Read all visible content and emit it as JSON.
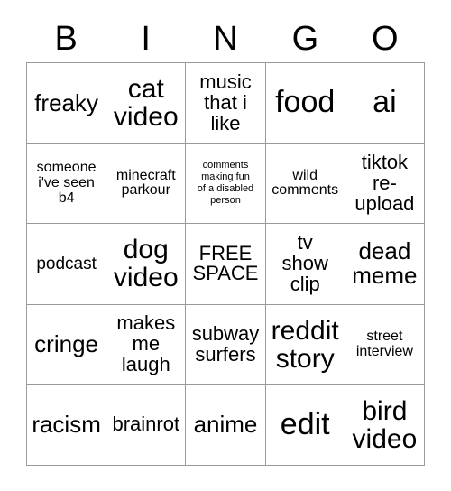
{
  "card": {
    "title": "BINGO",
    "header_letters": [
      "B",
      "I",
      "N",
      "G",
      "O"
    ],
    "grid_size": "5x5",
    "free_space_position": "center",
    "colors": {
      "background": "#ffffff",
      "text": "#000000",
      "grid_line": "#9a9a9a"
    },
    "rows": [
      [
        {
          "text": "freaky",
          "size": "s-lg"
        },
        {
          "text": "cat\nvideo",
          "size": "s-xl"
        },
        {
          "text": "music\nthat i\nlike",
          "size": "s-md"
        },
        {
          "text": "food",
          "size": "s-xxl"
        },
        {
          "text": "ai",
          "size": "s-xxl"
        }
      ],
      [
        {
          "text": "someone\ni've seen\nb4",
          "size": "s-xs"
        },
        {
          "text": "minecraft\nparkour",
          "size": "s-xs"
        },
        {
          "text": "comments\nmaking fun\nof a disabled\nperson",
          "size": "s-xxs"
        },
        {
          "text": "wild\ncomments",
          "size": "s-xs"
        },
        {
          "text": "tiktok\nre-\nupload",
          "size": "s-md"
        }
      ],
      [
        {
          "text": "podcast",
          "size": "s-sm"
        },
        {
          "text": "dog\nvideo",
          "size": "s-xl"
        },
        {
          "text": "FREE\nSPACE",
          "size": "s-md"
        },
        {
          "text": "tv\nshow\nclip",
          "size": "s-md"
        },
        {
          "text": "dead\nmeme",
          "size": "s-lg"
        }
      ],
      [
        {
          "text": "cringe",
          "size": "s-lg"
        },
        {
          "text": "makes\nme\nlaugh",
          "size": "s-md"
        },
        {
          "text": "subway\nsurfers",
          "size": "s-md"
        },
        {
          "text": "reddit\nstory",
          "size": "s-xl"
        },
        {
          "text": "street\ninterview",
          "size": "s-xs"
        }
      ],
      [
        {
          "text": "racism",
          "size": "s-lg"
        },
        {
          "text": "brainrot",
          "size": "s-md"
        },
        {
          "text": "anime",
          "size": "s-lg"
        },
        {
          "text": "edit",
          "size": "s-xxl"
        },
        {
          "text": "bird\nvideo",
          "size": "s-xl"
        }
      ]
    ]
  }
}
